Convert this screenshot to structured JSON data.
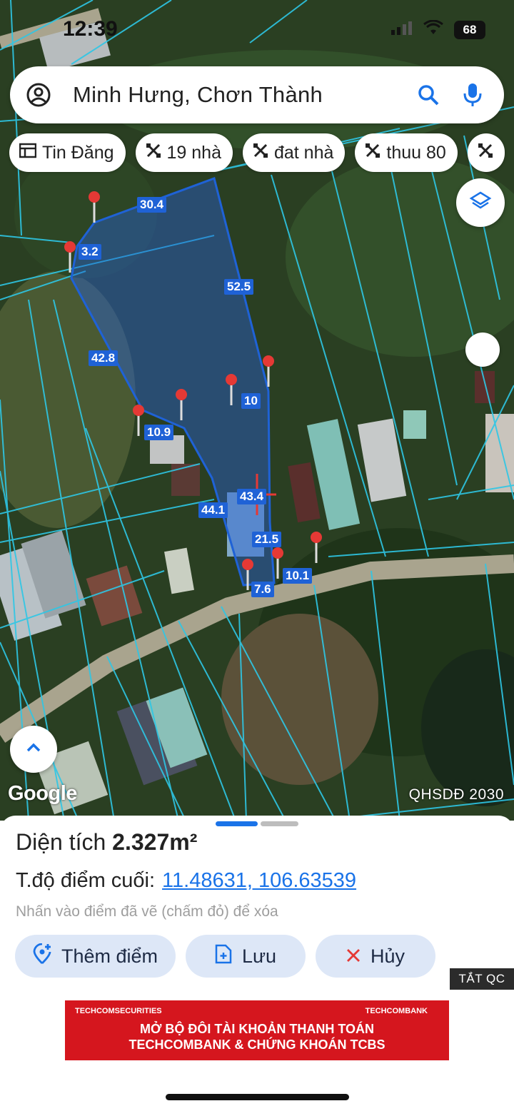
{
  "status_bar": {
    "time": "12:39",
    "battery": "68"
  },
  "search": {
    "query": "Minh Hưng, Chơn Thành"
  },
  "chips": [
    {
      "label": "Tin Đăng",
      "icon": "news-icon"
    },
    {
      "label": "19 nhà",
      "icon": "tools-icon"
    },
    {
      "label": "đat nhà",
      "icon": "tools-icon"
    },
    {
      "label": "thuu 80",
      "icon": "tools-icon"
    }
  ],
  "map": {
    "attribution": "Google",
    "layer_label": "QHSDĐ 2030",
    "edge_labels": [
      "30.4",
      "3.2",
      "52.5",
      "42.8",
      "10",
      "10.9",
      "43.4",
      "44.1",
      "21.5",
      "10.1",
      "7.6"
    ]
  },
  "sheet": {
    "area_prefix": "Diện tích",
    "area_value": "2.327m²",
    "coord_prefix": "T.độ điểm cuối:",
    "coord_value": "11.48631, 106.63539",
    "hint": "Nhấn vào điểm đã vẽ (chấm đỏ) để xóa",
    "buttons": {
      "add": "Thêm điểm",
      "save": "Lưu",
      "cancel": "Hủy"
    }
  },
  "ad": {
    "close_label": "TẮT QC",
    "brand_left": "TECHCOMSECURITIES",
    "brand_right": "TECHCOMBANK",
    "line1": "MỞ BỘ ĐÔI TÀI KHOẢN THANH TOÁN",
    "line2": "TECHCOMBANK & CHỨNG KHOÁN TCBS"
  },
  "colors": {
    "accent": "#1a73e8",
    "polygon": "#1f62d6",
    "pin": "#e53935",
    "ad": "#d5161e"
  }
}
